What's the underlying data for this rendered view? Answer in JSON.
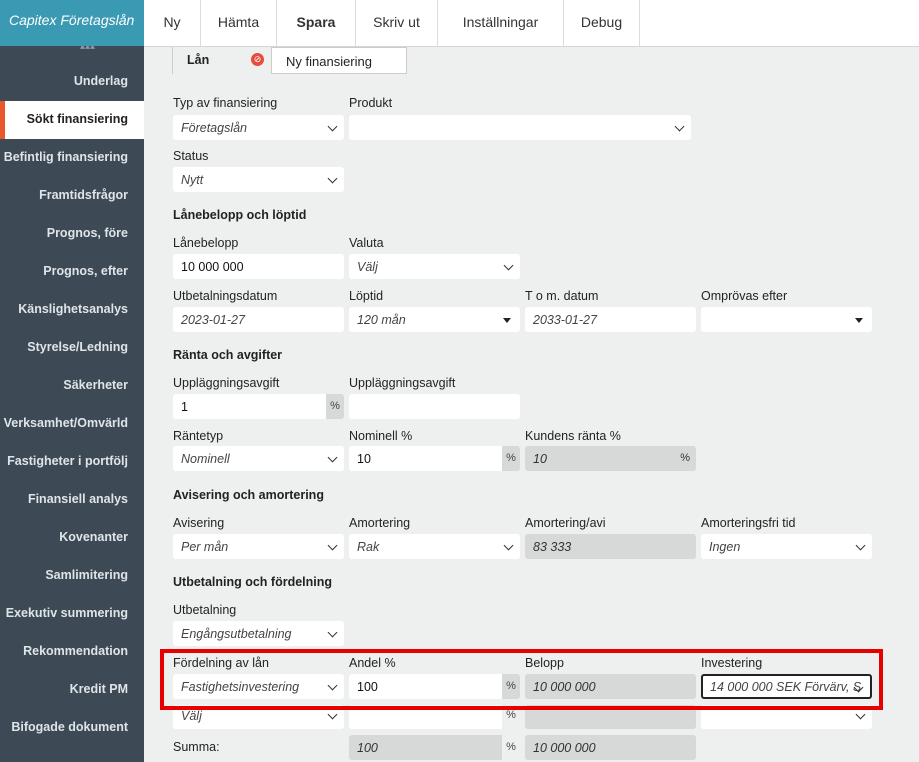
{
  "brand": "Capitex Företagslån",
  "topnav": [
    {
      "label": "Ny",
      "bold": false,
      "w": 57
    },
    {
      "label": "Hämta",
      "bold": false,
      "w": 76
    },
    {
      "label": "Spara",
      "bold": true,
      "w": 79
    },
    {
      "label": "Skriv ut",
      "bold": false,
      "w": 82
    },
    {
      "label": "Inställningar",
      "bold": false,
      "w": 126
    },
    {
      "label": "Debug",
      "bold": false,
      "w": 76
    }
  ],
  "sidebar": [
    "Underlag",
    "Sökt finansiering",
    "Befintlig finansiering",
    "Framtidsfrågor",
    "Prognos, före",
    "Prognos, efter",
    "Känslighetsanalys",
    "Styrelse/Ledning",
    "Säkerheter",
    "Verksamhet/Omvärld",
    "Fastigheter i portfölj",
    "Finansiell analys",
    "Kovenanter",
    "Samlimitering",
    "Exekutiv summering",
    "Rekommendation",
    "Kredit PM",
    "Bifogade dokument"
  ],
  "sidebar_active": "Sökt finansiering",
  "loan_tab": {
    "label": "Lån",
    "name": "Ny finansiering"
  },
  "labels": {
    "typ": "Typ av finansiering",
    "produkt": "Produkt",
    "status": "Status",
    "sec_lanebelopp": "Lånebelopp och löptid",
    "lanebelopp": "Lånebelopp",
    "valuta": "Valuta",
    "utbetalningsdatum": "Utbetalningsdatum",
    "loptid": "Löptid",
    "tom": "T o m. datum",
    "omprovas": "Omprövas efter",
    "sec_ranta": "Ränta och avgifter",
    "uppl1": "Uppläggningsavgift",
    "uppl2": "Uppläggningsavgift",
    "rantetyp": "Räntetyp",
    "nominell": "Nominell %",
    "kundens": "Kundens ränta %",
    "sec_avisering": "Avisering och amortering",
    "avisering": "Avisering",
    "amortering": "Amortering",
    "amort_avi": "Amortering/avi",
    "amortfri": "Amorteringsfri tid",
    "sec_utbetalning": "Utbetalning och fördelning",
    "utbetalning": "Utbetalning",
    "fordelning": "Fördelning av lån",
    "andel": "Andel %",
    "belopp": "Belopp",
    "investering": "Investering",
    "summa": "Summa:"
  },
  "values": {
    "typ": "Företagslån",
    "produkt": "",
    "status": "Nytt",
    "lanebelopp": "10 000 000",
    "valuta": "Välj",
    "utbetalningsdatum": "2023-01-27",
    "loptid": "120 mån",
    "tom": "2033-01-27",
    "omprovas": "",
    "uppl1": "1",
    "uppl2": "",
    "rantetyp": "Nominell",
    "nominell": "10",
    "kundens": "10",
    "avisering": "Per mån",
    "amortering": "Rak",
    "amort_avi": "83 333",
    "amortfri": "Ingen",
    "utbetalning": "Engångsutbetalning",
    "row1_fordelning": "Fastighetsinvestering",
    "row1_andel": "100",
    "row1_belopp": "10 000 000",
    "row1_investering": "14 000 000 SEK Förvärv, S",
    "row2_fordelning": "Välj",
    "row2_andel": "",
    "row2_belopp": "",
    "row2_investering": "",
    "summa_andel": "100",
    "summa_belopp": "10 000 000"
  },
  "pct_sign": "%",
  "colors": {
    "brand": "#3a9ab4",
    "sidebar": "#3d4a55",
    "active_marker": "#e8582c",
    "highlight": "#e60000"
  }
}
